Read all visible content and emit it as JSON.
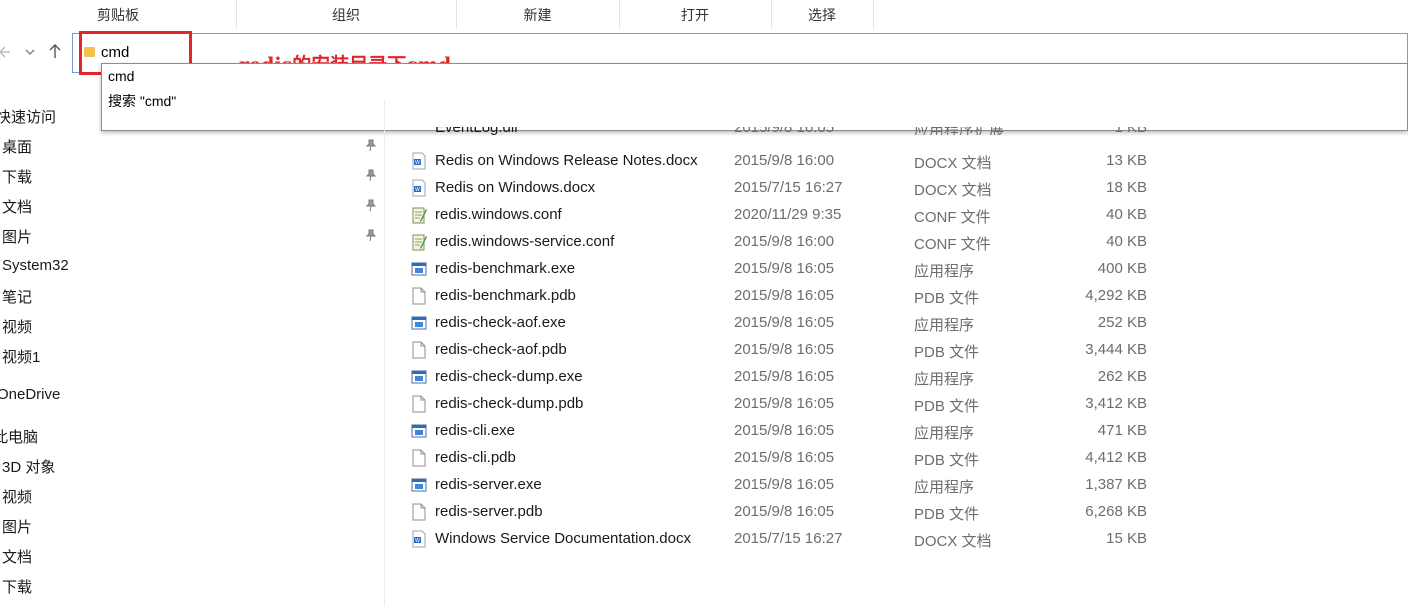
{
  "ribbon": {
    "groups": [
      "剪贴板",
      "组织",
      "新建",
      "打开",
      "选择"
    ]
  },
  "nav": {
    "back_icon": "arrow-left-icon",
    "forward_icon": "chevron-down-icon",
    "up_icon": "arrow-up-icon",
    "address_value": "cmd"
  },
  "annotation": {
    "text": "redis的安装目录下cmd",
    "color": "#e3242b"
  },
  "dropdown": {
    "items": [
      "cmd",
      "搜索 \"cmd\""
    ]
  },
  "sidebar": {
    "items": [
      {
        "label": "快速访问",
        "pinned": false
      },
      {
        "label": "桌面",
        "pinned": true
      },
      {
        "label": "下载",
        "pinned": true
      },
      {
        "label": "文档",
        "pinned": true
      },
      {
        "label": "图片",
        "pinned": true
      },
      {
        "label": "System32",
        "pinned": false
      },
      {
        "label": "笔记",
        "pinned": false
      },
      {
        "label": "视频",
        "pinned": false
      },
      {
        "label": "视频1",
        "pinned": false
      },
      {
        "label": "OneDrive",
        "pinned": false
      },
      {
        "label": "此电脑",
        "pinned": false
      },
      {
        "label": "3D 对象",
        "pinned": false
      },
      {
        "label": "视频",
        "pinned": false
      },
      {
        "label": "图片",
        "pinned": false
      },
      {
        "label": "文档",
        "pinned": false
      },
      {
        "label": "下载",
        "pinned": false
      }
    ]
  },
  "files": {
    "partial": {
      "name": "EventLog.dll",
      "date": "2015/9/8 16:05",
      "type": "应用程序扩展",
      "size": "1 KB",
      "icon": "dll-icon"
    },
    "rows": [
      {
        "name": "Redis on Windows Release Notes.docx",
        "date": "2015/9/8 16:00",
        "type": "DOCX 文档",
        "size": "13 KB",
        "icon": "docx-icon"
      },
      {
        "name": "Redis on Windows.docx",
        "date": "2015/7/15 16:27",
        "type": "DOCX 文档",
        "size": "18 KB",
        "icon": "docx-icon"
      },
      {
        "name": "redis.windows.conf",
        "date": "2020/11/29 9:35",
        "type": "CONF 文件",
        "size": "40 KB",
        "icon": "conf-icon"
      },
      {
        "name": "redis.windows-service.conf",
        "date": "2015/9/8 16:00",
        "type": "CONF 文件",
        "size": "40 KB",
        "icon": "conf-icon"
      },
      {
        "name": "redis-benchmark.exe",
        "date": "2015/9/8 16:05",
        "type": "应用程序",
        "size": "400 KB",
        "icon": "exe-icon"
      },
      {
        "name": "redis-benchmark.pdb",
        "date": "2015/9/8 16:05",
        "type": "PDB 文件",
        "size": "4,292 KB",
        "icon": "file-icon"
      },
      {
        "name": "redis-check-aof.exe",
        "date": "2015/9/8 16:05",
        "type": "应用程序",
        "size": "252 KB",
        "icon": "exe-icon"
      },
      {
        "name": "redis-check-aof.pdb",
        "date": "2015/9/8 16:05",
        "type": "PDB 文件",
        "size": "3,444 KB",
        "icon": "file-icon"
      },
      {
        "name": "redis-check-dump.exe",
        "date": "2015/9/8 16:05",
        "type": "应用程序",
        "size": "262 KB",
        "icon": "exe-icon"
      },
      {
        "name": "redis-check-dump.pdb",
        "date": "2015/9/8 16:05",
        "type": "PDB 文件",
        "size": "3,412 KB",
        "icon": "file-icon"
      },
      {
        "name": "redis-cli.exe",
        "date": "2015/9/8 16:05",
        "type": "应用程序",
        "size": "471 KB",
        "icon": "exe-icon"
      },
      {
        "name": "redis-cli.pdb",
        "date": "2015/9/8 16:05",
        "type": "PDB 文件",
        "size": "4,412 KB",
        "icon": "file-icon"
      },
      {
        "name": "redis-server.exe",
        "date": "2015/9/8 16:05",
        "type": "应用程序",
        "size": "1,387 KB",
        "icon": "exe-icon"
      },
      {
        "name": "redis-server.pdb",
        "date": "2015/9/8 16:05",
        "type": "PDB 文件",
        "size": "6,268 KB",
        "icon": "file-icon"
      },
      {
        "name": "Windows Service Documentation.docx",
        "date": "2015/7/15 16:27",
        "type": "DOCX 文档",
        "size": "15 KB",
        "icon": "docx-icon"
      }
    ]
  }
}
